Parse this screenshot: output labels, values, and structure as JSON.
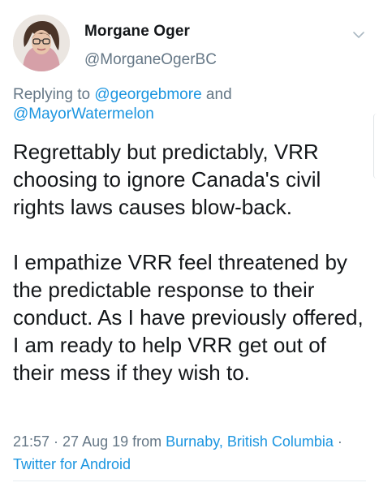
{
  "tweet": {
    "author": {
      "display_name": "Morgane Oger",
      "handle": "@MorganeOgerBC",
      "avatar_icon": "profile-photo"
    },
    "menu_icon": "chevron-down-icon",
    "reply": {
      "prefix": "Replying to ",
      "users": [
        "@georgebmore",
        "@MayorWatermelon"
      ],
      "joiner": " and"
    },
    "text": {
      "paragraph1": "Regrettably but predictably, VRR choosing to ignore Canada's civil rights laws causes blow-back.",
      "paragraph2": "I empathize VRR feel threatened by the predictable response to their conduct.  As I have previously offered, I am ready to help VRR get out of their mess if they wish to."
    },
    "meta": {
      "time": "21:57",
      "separator": " · ",
      "date": "27 Aug 19",
      "from_label": " from ",
      "location": "Burnaby, British Columbia",
      "source": "Twitter for Android"
    },
    "colors": {
      "link": "#1b95e0",
      "secondary": "#657786",
      "primary": "#14171a"
    }
  }
}
